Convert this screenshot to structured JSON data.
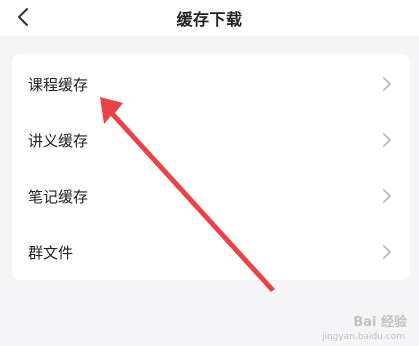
{
  "header": {
    "title": "缓存下载",
    "back_icon": "chevron-left-icon"
  },
  "menu": {
    "items": [
      {
        "label": "课程缓存",
        "icon": "chevron-right-icon"
      },
      {
        "label": "讲义缓存",
        "icon": "chevron-right-icon"
      },
      {
        "label": "笔记缓存",
        "icon": "chevron-right-icon"
      },
      {
        "label": "群文件",
        "icon": "chevron-right-icon"
      }
    ]
  },
  "annotation": {
    "arrow_color": "#e8383d"
  },
  "watermark": {
    "text": "Bai 经验",
    "sub": "jingyan.baidu.com"
  },
  "colors": {
    "background": "#f5f5f7",
    "card": "#ffffff",
    "text": "#222222",
    "chevron": "#b5b5b5"
  }
}
